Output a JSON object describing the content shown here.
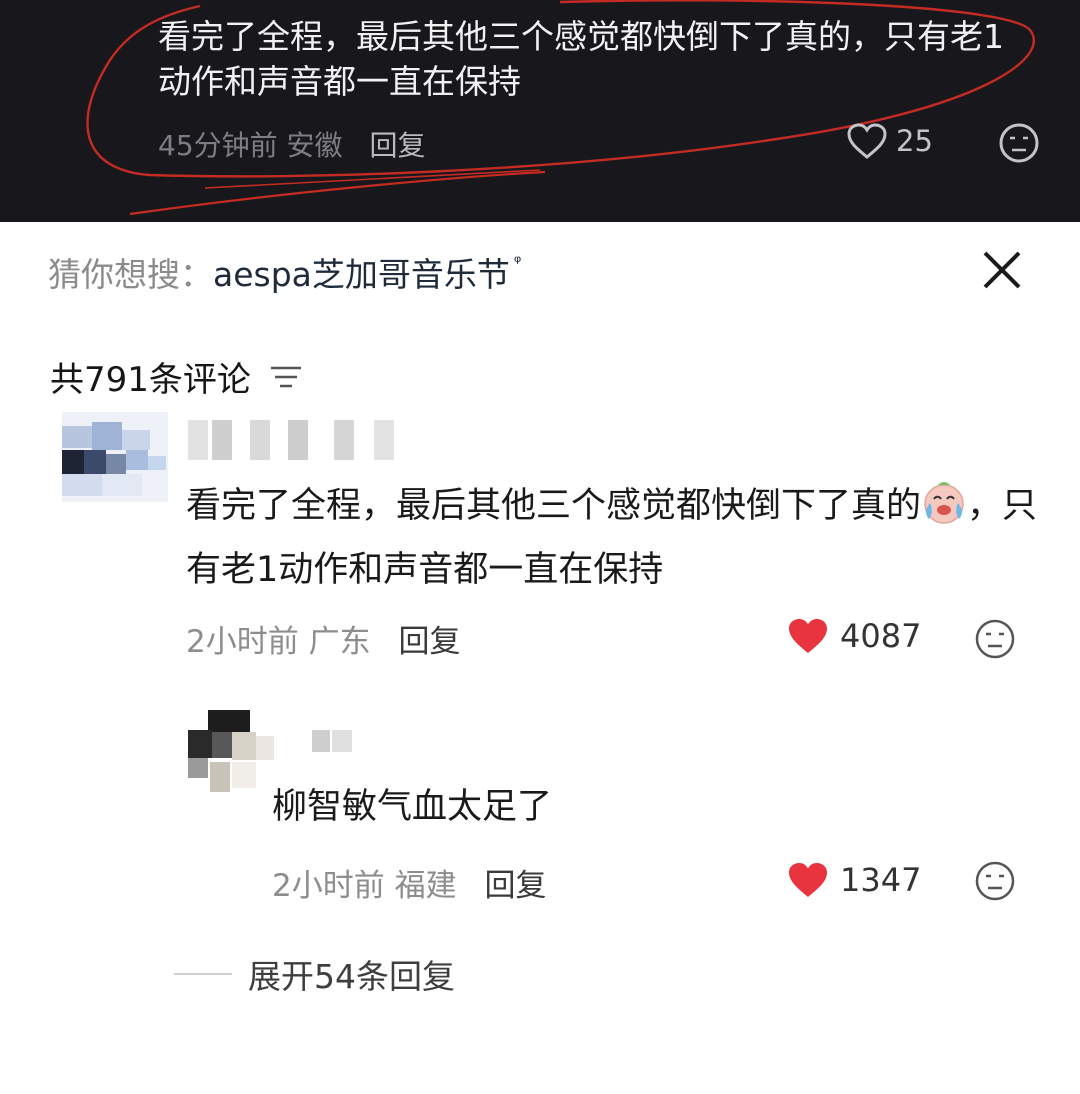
{
  "top_comment": {
    "text_line1": "看完了全程，最后其他三个感觉都快倒下了真的，只有老1",
    "text_line2": "动作和声音都一直在保持",
    "time": "45分钟前",
    "location": "安徽",
    "reply_label": "回复",
    "likes": "25"
  },
  "search_suggestion": {
    "prefix": "猜你想搜：",
    "term": "aespa芝加哥音乐节",
    "icon": "search-icon"
  },
  "comments_header": {
    "count_label": "共791条评论",
    "icon": "filter-icon"
  },
  "main_comment": {
    "text_before_emoji": "看完了全程，最后其他三个感觉都快倒下了真的",
    "emoji": "crying-laugh-emoji",
    "text_after_emoji": "，只有老1动作和声音都一直在保持",
    "time": "2小时前",
    "location": "广东",
    "reply_label": "回复",
    "likes": "4087"
  },
  "sub_comment": {
    "text": "柳智敏气血太足了",
    "time": "2小时前",
    "location": "福建",
    "reply_label": "回复",
    "likes": "1347"
  },
  "expand_replies": {
    "label": "展开54条回复"
  },
  "colors": {
    "dark_bg": "#18181c",
    "annotation_red": "#c42b23",
    "liked_heart": "#e8343f",
    "meta_gray": "#8d8d8d"
  }
}
